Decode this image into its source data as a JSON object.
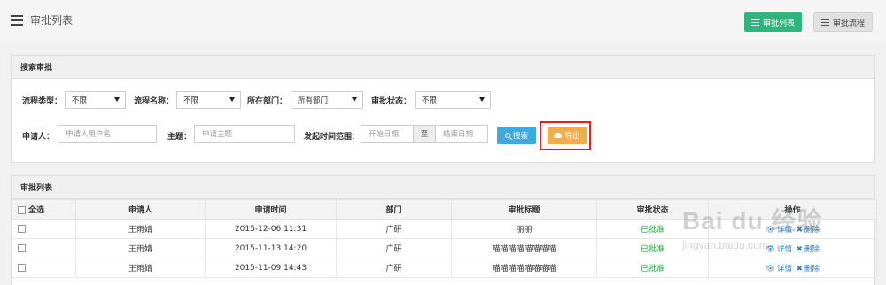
{
  "header": {
    "title": "审批列表",
    "buttons": [
      {
        "label": "审批列表",
        "icon": "list-icon",
        "active": true,
        "color": "#2fb47c"
      },
      {
        "label": "审批流程",
        "icon": "list-icon",
        "active": false
      }
    ]
  },
  "search": {
    "title": "搜索审批",
    "row1": {
      "flow_type": {
        "label": "流程类型：",
        "value": "不限"
      },
      "flow_name": {
        "label": "流程名称：",
        "value": "不限"
      },
      "department": {
        "label": "所在部门：",
        "value": "所有部门"
      },
      "status": {
        "label": "审批状态：",
        "value": "不限"
      }
    },
    "row2": {
      "applicant": {
        "label": "申请人：",
        "placeholder": "申请人用户名"
      },
      "subject": {
        "label": "主题：",
        "placeholder": "申请主题"
      },
      "time_range": {
        "label": "发起时间范围：",
        "start_placeholder": "开始日期",
        "separator": "至",
        "end_placeholder": "结束日期"
      },
      "search_button": "搜索",
      "export_button": "导出"
    },
    "accent_colors": {
      "search": "#3fa9e0",
      "export": "#f0ad4e",
      "highlight": "#e2231a"
    }
  },
  "list": {
    "title": "审批列表",
    "columns": [
      "全选",
      "申请人",
      "申请时间",
      "部门",
      "审批标题",
      "审批状态",
      "操作"
    ],
    "rows": [
      {
        "applicant": "王雨婧",
        "time": "2015-12-06 11:31",
        "dept": "广研",
        "title": "丽丽",
        "status": "已批准",
        "ops": [
          "详情",
          "删除"
        ]
      },
      {
        "applicant": "王雨婧",
        "time": "2015-11-13 14:20",
        "dept": "广研",
        "title": "喵喵喵喵喵喵喵喵",
        "status": "已批准",
        "ops": [
          "详情",
          "删除"
        ]
      },
      {
        "applicant": "王雨婧",
        "time": "2015-11-09 14:43",
        "dept": "广研",
        "title": "喵喵喵喵喵喵喵喵",
        "status": "已批准",
        "ops": [
          "详情",
          "删除"
        ]
      }
    ],
    "status_color": "#27a844"
  },
  "watermark": {
    "main": "Bai du 经验",
    "sub": "jingyan.baidu.com"
  }
}
